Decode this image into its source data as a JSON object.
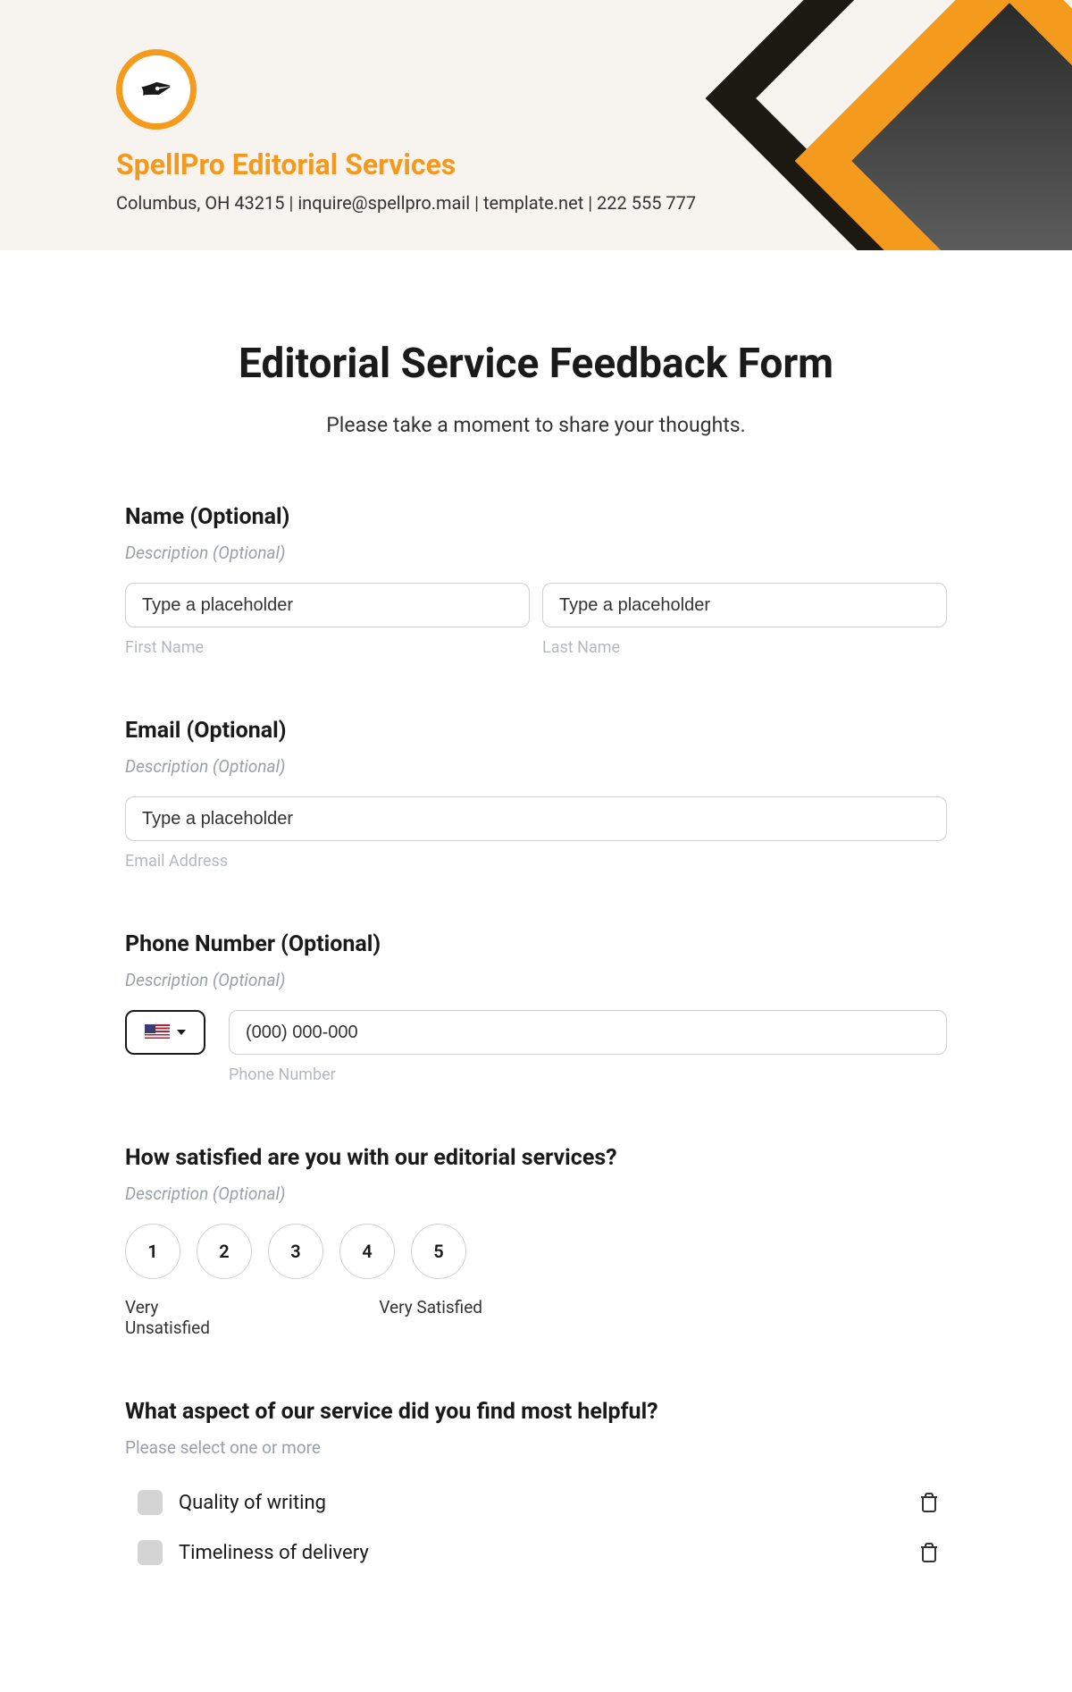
{
  "header": {
    "brand_name": "SpellPro Editorial Services",
    "contact_line": "Columbus, OH 43215 | inquire@spellpro.mail | template.net | 222 555 777",
    "logo_alt": "pen-logo"
  },
  "form": {
    "title": "Editorial Service Feedback Form",
    "subtitle": "Please take a moment to share your thoughts.",
    "name": {
      "label": "Name (Optional)",
      "desc": "Description (Optional)",
      "first_placeholder": "Type a placeholder",
      "first_sub": "First Name",
      "last_placeholder": "Type a placeholder",
      "last_sub": "Last Name"
    },
    "email": {
      "label": "Email (Optional)",
      "desc": "Description (Optional)",
      "placeholder": "Type a placeholder",
      "sub": "Email Address"
    },
    "phone": {
      "label": "Phone Number (Optional)",
      "desc": "Description (Optional)",
      "placeholder": "(000) 000-000",
      "sub": "Phone Number",
      "country": "US"
    },
    "satisfaction": {
      "label": "How satisfied are you with our editorial services?",
      "desc": "Description (Optional)",
      "options": [
        "1",
        "2",
        "3",
        "4",
        "5"
      ],
      "low_label": "Very Unsatisfied",
      "high_label": "Very Satisfied"
    },
    "aspect": {
      "label": "What aspect of our service did you find most helpful?",
      "desc": "Please select one or more",
      "options": [
        "Quality of writing",
        "Timeliness of delivery"
      ]
    }
  }
}
